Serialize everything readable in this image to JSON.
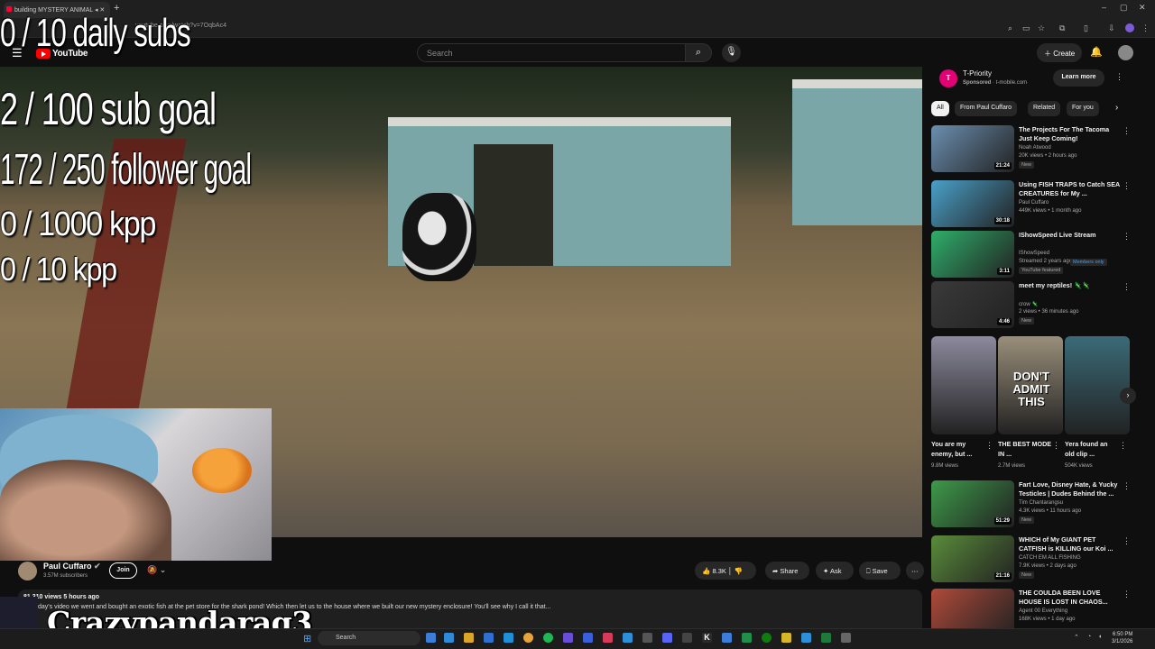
{
  "browser": {
    "tab_title": "building MYSTERY ANIMAL",
    "new_tab_icon": "plus-icon",
    "url": "youtube.com/watch?v=7OqbAc4",
    "window_buttons": [
      "–",
      "▢",
      "✕"
    ]
  },
  "header": {
    "logo_text": "YouTube",
    "search_placeholder": "Search",
    "create_label": "Create"
  },
  "overlays": {
    "line1": "0 / 10 daily subs",
    "line2": "2  / 100 sub goal",
    "line3": "172 / 250 follower goal",
    "line4": "0 / 1000 kpp",
    "line5": "0 / 10 kpp",
    "streamer_name": "Crazypandarag3"
  },
  "video": {
    "channel_name": "Paul Cuffaro",
    "channel_subs": "3.57M subscribers",
    "join_label": "Join",
    "like_count": "8.3K",
    "share_label": "Share",
    "ask_label": "Ask",
    "save_label": "Save",
    "views_time": "81,310 views  5 hours ago",
    "description": "day's video we went and bought an exotic fish at the pet store for the shark pond! Which then let us to the house where we built our new mystery enclosure! You'll see why I call it that..."
  },
  "sidebar": {
    "ad": {
      "logo_letter": "T",
      "title": "T-Priority",
      "sponsored": "Sponsored",
      "domain": "t-mobile.com",
      "cta": "Learn more"
    },
    "chips": [
      "All",
      "From Paul Cuffaro",
      "Related",
      "For you"
    ],
    "recs": [
      {
        "title": "The Projects For The Tacoma Just Keep Coming!",
        "channel": "Noah Atwood",
        "meta": "20K views • 2 hours ago",
        "badge": "New",
        "duration": "21:24",
        "color": "#6b8fb0"
      },
      {
        "title": "Using FISH TRAPS to Catch SEA CREATURES for My ...",
        "channel": "Paul Cuffaro",
        "meta": "449K views • 1 month ago",
        "badge": "",
        "duration": "30:18",
        "color": "#4aa0c9"
      },
      {
        "title": "IShowSpeed Live Stream",
        "channel": "IShowSpeed",
        "meta": "Streamed 2 years ago",
        "badge": "YouTube featured",
        "badge2": "Members only",
        "duration": "3:11",
        "color": "#2fae6a"
      },
      {
        "title": "meet my reptiles! 🦎🦎",
        "channel": "crow 🦎",
        "meta": "2 views • 36 minutes ago",
        "badge": "New",
        "duration": "4:46",
        "color": "#3a3a3a"
      }
    ],
    "shorts": [
      {
        "title": "You are my enemy, but ...",
        "views": "9.8M views",
        "color": "#8c8a9c"
      },
      {
        "title": "THE BEST MODE IN ...",
        "views": "2.7M views",
        "color": "#9a8f7a",
        "overlay": "DON'T ADMIT THIS"
      },
      {
        "title": "Yera found an old clip ...",
        "views": "504K views",
        "color": "#3a6b78"
      }
    ],
    "recs2": [
      {
        "title": "Fart Love, Disney Hate, & Yucky Testicles | Dudes Behind the ...",
        "channel": "Tim Chantarangsu",
        "meta": "4.3K views • 11 hours ago",
        "badge": "New",
        "duration": "51:29",
        "color": "#3e9a4a"
      },
      {
        "title": "WHICH of My GIANT PET CATFISH is KILLING our Koi ...",
        "channel": "CATCH EM ALL FISHING",
        "meta": "7.9K views • 2 days ago",
        "badge": "New",
        "duration": "21:16",
        "color": "#5a8c3a"
      },
      {
        "title": "THE COULDA BEEN LOVE HOUSE IS LOST IN CHAOS...",
        "channel": "Agent 00 Everything",
        "meta": "168K views • 1 day ago",
        "badge": "",
        "duration": "",
        "color": "#b04a3a"
      }
    ]
  },
  "taskbar": {
    "search_label": "Search",
    "time": "6:50 PM",
    "date": "3/1/2026"
  }
}
